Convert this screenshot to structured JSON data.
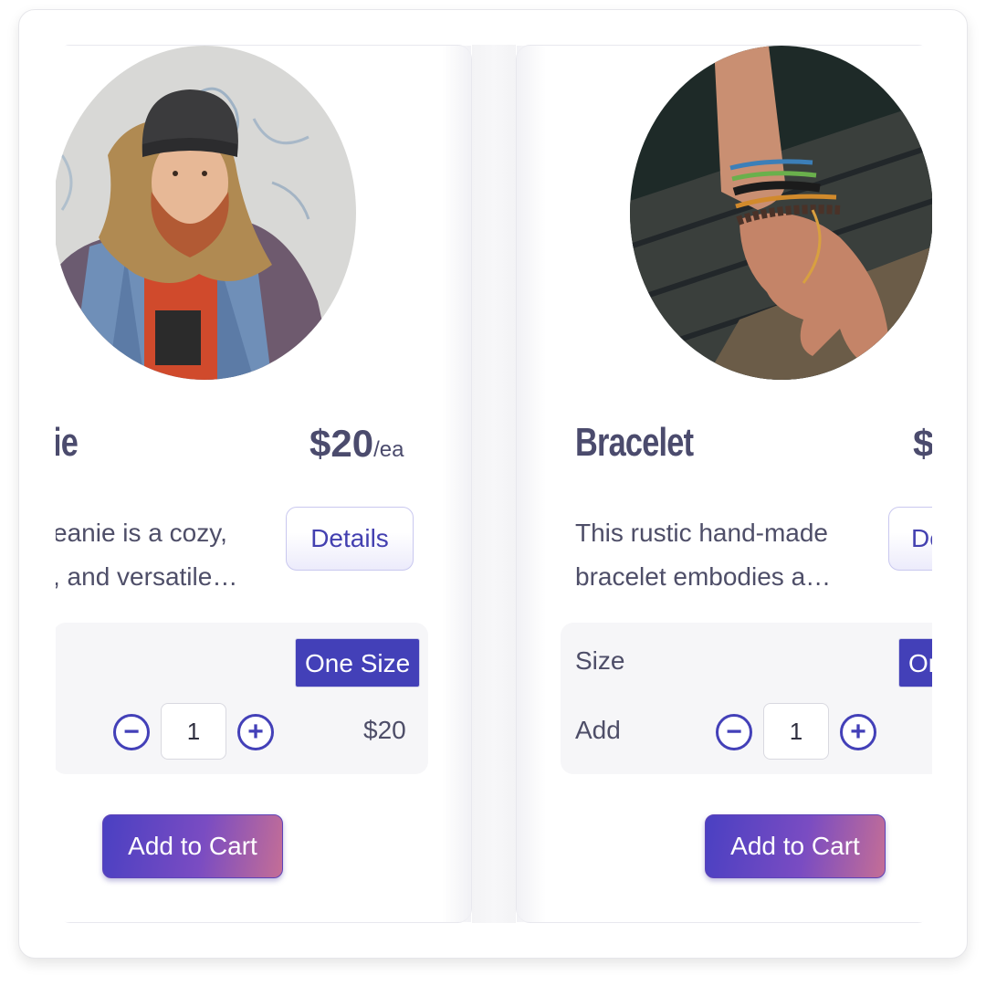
{
  "products": [
    {
      "title": "ie",
      "price": "$20",
      "price_unit": "/ea",
      "description_line1": "eanie is a cozy,",
      "description_line2": ", and versatile…",
      "details_label": "Details",
      "size_label": "",
      "size_value": "One Size",
      "add_label": "",
      "quantity": "1",
      "line_total": "$20",
      "add_to_cart_label": "Add to Cart",
      "photo": "man-in-beanie-photo"
    },
    {
      "title": "Bracelet",
      "price": "$",
      "price_unit": "",
      "description_line1": "This rustic hand-made",
      "description_line2": "bracelet embodies a…",
      "details_label": "De",
      "size_label": "Size",
      "size_value": "On",
      "add_label": "Add",
      "quantity": "1",
      "line_total": "",
      "add_to_cart_label": "Add to Cart",
      "photo": "wrist-with-bracelets-photo"
    }
  ],
  "icons": {
    "minus": "−",
    "plus": "+"
  },
  "colors": {
    "accent": "#4340b8",
    "title_text": "#4b4b6d",
    "panel_bg": "#f6f6f8",
    "cart_gradient_start": "#4a40c2",
    "cart_gradient_end": "#c46e96"
  }
}
